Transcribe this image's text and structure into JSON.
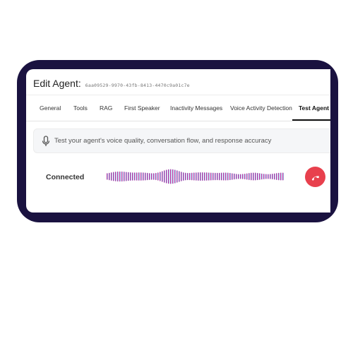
{
  "header": {
    "title": "Edit Agent:",
    "agent_id": "6aa09529-9970-43fb-8413-4470c9a01c7e"
  },
  "tabs": [
    {
      "label": "General",
      "active": false
    },
    {
      "label": "Tools",
      "active": false
    },
    {
      "label": "RAG",
      "active": false
    },
    {
      "label": "First Speaker",
      "active": false
    },
    {
      "label": "Inactivity Messages",
      "active": false
    },
    {
      "label": "Voice Activity Detection",
      "active": false
    },
    {
      "label": "Test Agent",
      "active": true
    }
  ],
  "info_bar": {
    "icon": "microphone-icon",
    "text": "Test your agent's voice quality, conversation flow, and response accuracy"
  },
  "call": {
    "status": "Connected",
    "hangup_icon": "phone-hangup-icon",
    "hangup_color": "#e8404d"
  },
  "colors": {
    "frame": "#1a1240",
    "wave_start": "#7c3aed",
    "wave_mid": "#e0287a",
    "wave_end": "#38bdf8"
  }
}
